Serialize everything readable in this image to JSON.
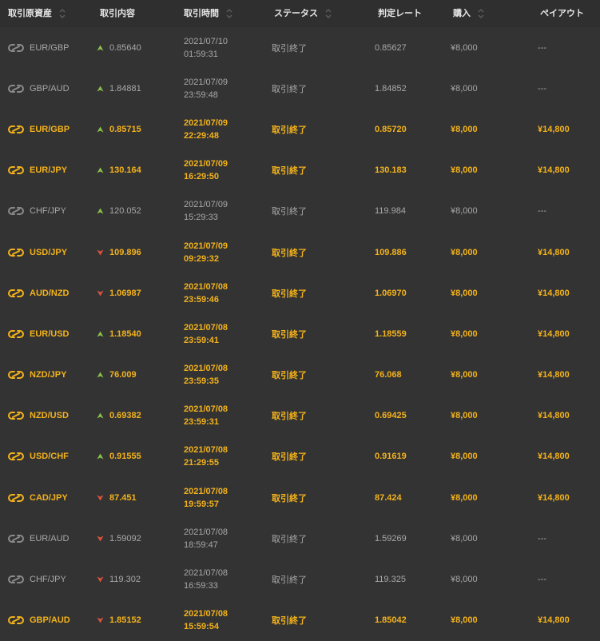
{
  "headers": {
    "asset": "取引原資産",
    "content": "取引内容",
    "time": "取引時間",
    "status": "ステータス",
    "rate": "判定レート",
    "buy": "購入",
    "payout": "ペイアウト"
  },
  "colors": {
    "background": "#333333",
    "win_text": "#f3b21b",
    "lose_text": "#a8a8a8",
    "up_arrow": "#8bc34a",
    "down_arrow": "#e0533b"
  },
  "rows": [
    {
      "asset": "EUR/GBP",
      "direction": "up",
      "entry": "0.85640",
      "date": "2021/07/10",
      "time": "01:59:31",
      "status": "取引終了",
      "rate": "0.85627",
      "buy": "¥8,000",
      "payout": "---",
      "result": "lose"
    },
    {
      "asset": "GBP/AUD",
      "direction": "up",
      "entry": "1.84881",
      "date": "2021/07/09",
      "time": "23:59:48",
      "status": "取引終了",
      "rate": "1.84852",
      "buy": "¥8,000",
      "payout": "---",
      "result": "lose"
    },
    {
      "asset": "EUR/GBP",
      "direction": "up",
      "entry": "0.85715",
      "date": "2021/07/09",
      "time": "22:29:48",
      "status": "取引終了",
      "rate": "0.85720",
      "buy": "¥8,000",
      "payout": "¥14,800",
      "result": "win"
    },
    {
      "asset": "EUR/JPY",
      "direction": "up",
      "entry": "130.164",
      "date": "2021/07/09",
      "time": "16:29:50",
      "status": "取引終了",
      "rate": "130.183",
      "buy": "¥8,000",
      "payout": "¥14,800",
      "result": "win"
    },
    {
      "asset": "CHF/JPY",
      "direction": "up",
      "entry": "120.052",
      "date": "2021/07/09",
      "time": "15:29:33",
      "status": "取引終了",
      "rate": "119.984",
      "buy": "¥8,000",
      "payout": "---",
      "result": "lose"
    },
    {
      "asset": "USD/JPY",
      "direction": "down",
      "entry": "109.896",
      "date": "2021/07/09",
      "time": "09:29:32",
      "status": "取引終了",
      "rate": "109.886",
      "buy": "¥8,000",
      "payout": "¥14,800",
      "result": "win"
    },
    {
      "asset": "AUD/NZD",
      "direction": "down",
      "entry": "1.06987",
      "date": "2021/07/08",
      "time": "23:59:46",
      "status": "取引終了",
      "rate": "1.06970",
      "buy": "¥8,000",
      "payout": "¥14,800",
      "result": "win"
    },
    {
      "asset": "EUR/USD",
      "direction": "up",
      "entry": "1.18540",
      "date": "2021/07/08",
      "time": "23:59:41",
      "status": "取引終了",
      "rate": "1.18559",
      "buy": "¥8,000",
      "payout": "¥14,800",
      "result": "win"
    },
    {
      "asset": "NZD/JPY",
      "direction": "up",
      "entry": "76.009",
      "date": "2021/07/08",
      "time": "23:59:35",
      "status": "取引終了",
      "rate": "76.068",
      "buy": "¥8,000",
      "payout": "¥14,800",
      "result": "win"
    },
    {
      "asset": "NZD/USD",
      "direction": "up",
      "entry": "0.69382",
      "date": "2021/07/08",
      "time": "23:59:31",
      "status": "取引終了",
      "rate": "0.69425",
      "buy": "¥8,000",
      "payout": "¥14,800",
      "result": "win"
    },
    {
      "asset": "USD/CHF",
      "direction": "up",
      "entry": "0.91555",
      "date": "2021/07/08",
      "time": "21:29:55",
      "status": "取引終了",
      "rate": "0.91619",
      "buy": "¥8,000",
      "payout": "¥14,800",
      "result": "win"
    },
    {
      "asset": "CAD/JPY",
      "direction": "down",
      "entry": "87.451",
      "date": "2021/07/08",
      "time": "19:59:57",
      "status": "取引終了",
      "rate": "87.424",
      "buy": "¥8,000",
      "payout": "¥14,800",
      "result": "win"
    },
    {
      "asset": "EUR/AUD",
      "direction": "down",
      "entry": "1.59092",
      "date": "2021/07/08",
      "time": "18:59:47",
      "status": "取引終了",
      "rate": "1.59269",
      "buy": "¥8,000",
      "payout": "---",
      "result": "lose"
    },
    {
      "asset": "CHF/JPY",
      "direction": "down",
      "entry": "119.302",
      "date": "2021/07/08",
      "time": "16:59:33",
      "status": "取引終了",
      "rate": "119.325",
      "buy": "¥8,000",
      "payout": "---",
      "result": "lose"
    },
    {
      "asset": "GBP/AUD",
      "direction": "down",
      "entry": "1.85152",
      "date": "2021/07/08",
      "time": "15:59:54",
      "status": "取引終了",
      "rate": "1.85042",
      "buy": "¥8,000",
      "payout": "¥14,800",
      "result": "win"
    }
  ]
}
